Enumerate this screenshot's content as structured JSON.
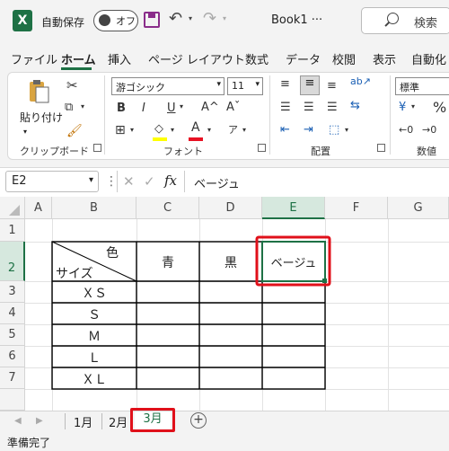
{
  "titlebar": {
    "logo": "X",
    "autosave_label": "自動保存",
    "autosave_state": "オフ",
    "book_title": "Book1",
    "book_title_more": "···",
    "search_placeholder": "検索",
    "icons": [
      "excel-logo-icon",
      "save-icon",
      "undo-icon",
      "redo-icon",
      "search-icon"
    ]
  },
  "ribbon_tabs": [
    "ファイル",
    "ホーム",
    "挿入",
    "ページ レイアウト",
    "数式",
    "データ",
    "校閲",
    "表示",
    "自動化"
  ],
  "active_tab": "ホーム",
  "clipboard": {
    "paste_label": "貼り付け",
    "group_label": "クリップボード"
  },
  "font": {
    "font_name": "游ゴシック",
    "font_size": "11",
    "bold": "B",
    "italic": "I",
    "underline": "U",
    "grow": "A^",
    "shrink": "Aˇ",
    "group_label": "フォント",
    "font_color": "#e81123",
    "fill_color": "#ffff00"
  },
  "alignment": {
    "group_label": "配置"
  },
  "number": {
    "format": "標準",
    "percent": "%",
    "group_label": "数値"
  },
  "formula_bar": {
    "name_box": "E2",
    "fx": "fx",
    "content": "ベージュ"
  },
  "columns": [
    "A",
    "B",
    "C",
    "D",
    "E",
    "F",
    "G"
  ],
  "rows": [
    "1",
    "2",
    "3",
    "4",
    "5",
    "6",
    "7"
  ],
  "table": {
    "corner_top": "色",
    "corner_bottom": "サイズ",
    "headers": [
      "青",
      "黒",
      "ベージュ"
    ],
    "sizes": [
      "ＸＳ",
      "Ｓ",
      "Ｍ",
      "Ｌ",
      "ＸＬ"
    ]
  },
  "sheets": [
    "1月",
    "2月",
    "3月"
  ],
  "active_sheet": "3月",
  "status": "準備完了",
  "highlight_color": "#e0101a",
  "accent_color": "#1e7145"
}
